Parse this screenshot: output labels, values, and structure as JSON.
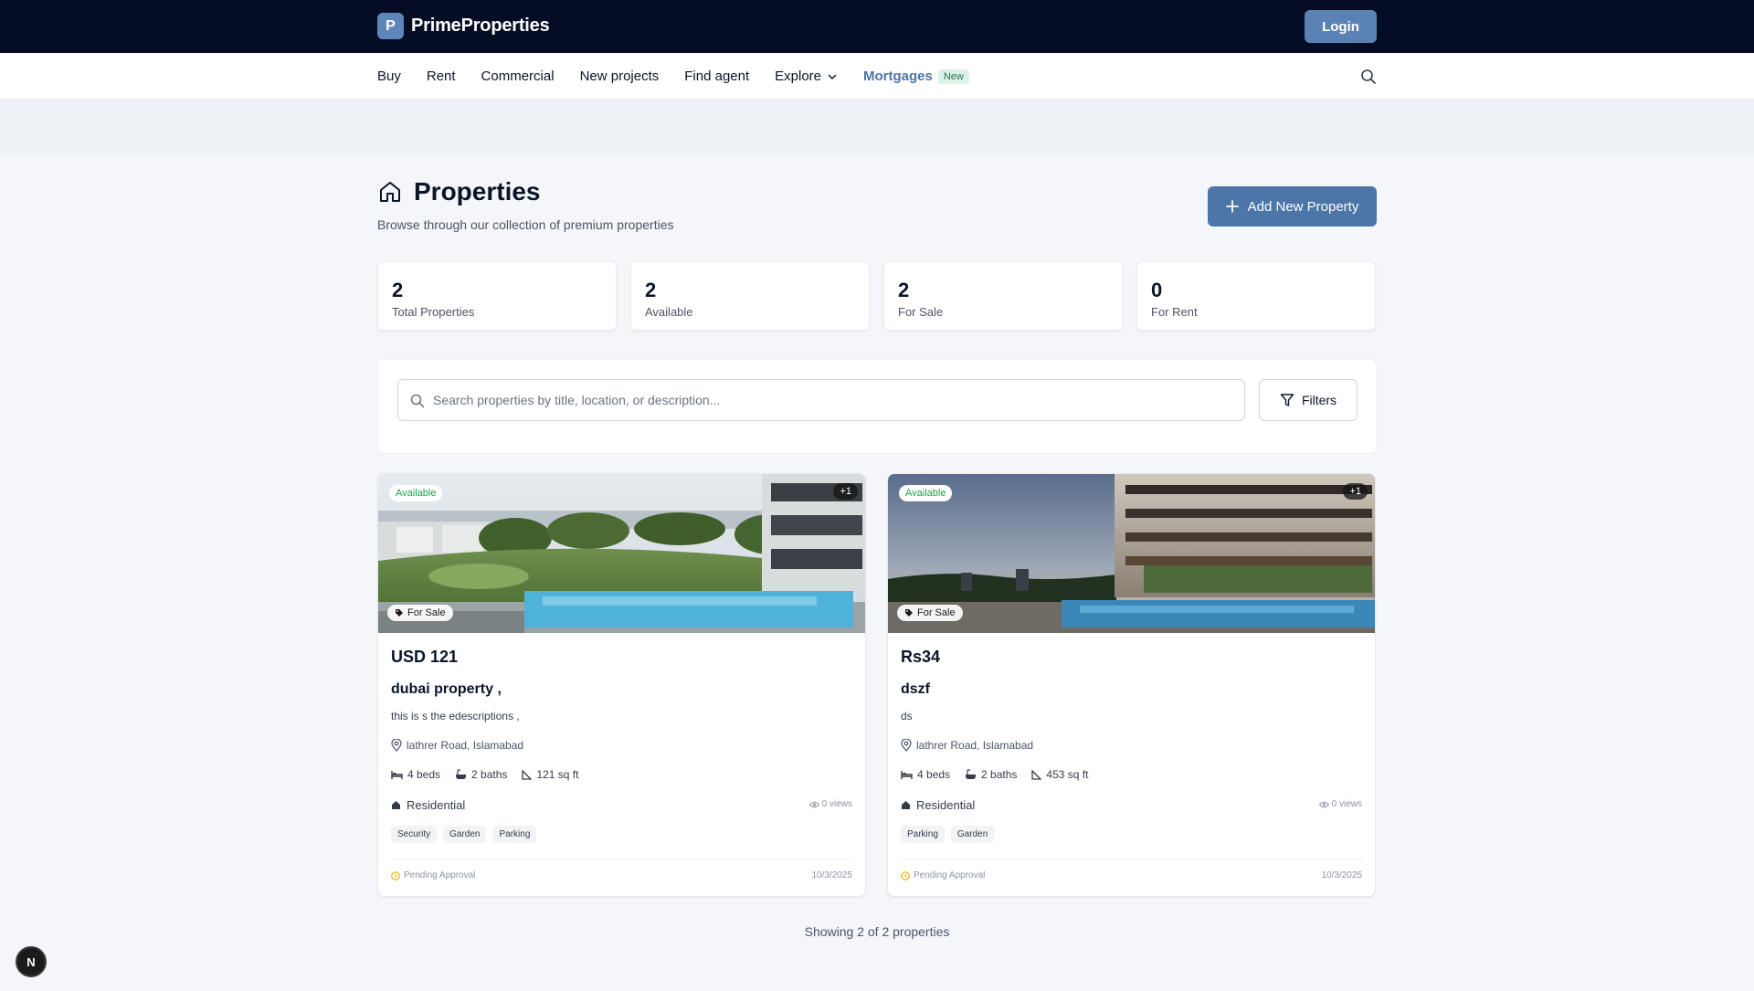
{
  "brand": {
    "logo_letter": "P",
    "name": "PrimeProperties"
  },
  "header": {
    "login_label": "Login"
  },
  "nav": {
    "items": [
      "Buy",
      "Rent",
      "Commercial",
      "New projects",
      "Find agent",
      "Explore"
    ],
    "mortgages_label": "Mortgages",
    "new_badge": "New"
  },
  "page": {
    "title": "Properties",
    "subtitle": "Browse through our collection of premium properties",
    "add_button": "Add New Property"
  },
  "stats": [
    {
      "value": "2",
      "label": "Total Properties"
    },
    {
      "value": "2",
      "label": "Available"
    },
    {
      "value": "2",
      "label": "For Sale"
    },
    {
      "value": "0",
      "label": "For Rent"
    }
  ],
  "search": {
    "placeholder": "Search properties by title, location, or description...",
    "value": "",
    "filters_label": "Filters"
  },
  "listings": [
    {
      "status_badge": "Available",
      "image_count_badge": "+1",
      "listing_type": "For Sale",
      "price": "USD 121",
      "title": "dubai property ,",
      "description": "this is s the edescriptions ,",
      "location": "lathrer Road, Islamabad",
      "beds": "4 beds",
      "baths": "2 baths",
      "area": "121 sq ft",
      "property_type": "Residential",
      "views": "0 views",
      "tags": [
        "Security",
        "Garden",
        "Parking"
      ],
      "approval": "Pending Approval",
      "date": "10/3/2025"
    },
    {
      "status_badge": "Available",
      "image_count_badge": "+1",
      "listing_type": "For Sale",
      "price": "Rs34",
      "title": "dszf",
      "description": "ds",
      "location": "lathrer Road, Islamabad",
      "beds": "4 beds",
      "baths": "2 baths",
      "area": "453 sq ft",
      "property_type": "Residential",
      "views": "0 views",
      "tags": [
        "Parking",
        "Garden"
      ],
      "approval": "Pending Approval",
      "date": "10/3/2025"
    }
  ],
  "footer": {
    "showing": "Showing 2 of 2 properties",
    "dev_badge": "N"
  },
  "colors": {
    "topbar": "#050d24",
    "accent": "#4d76a8",
    "available": "#17a34a",
    "pending": "#f5b100"
  }
}
